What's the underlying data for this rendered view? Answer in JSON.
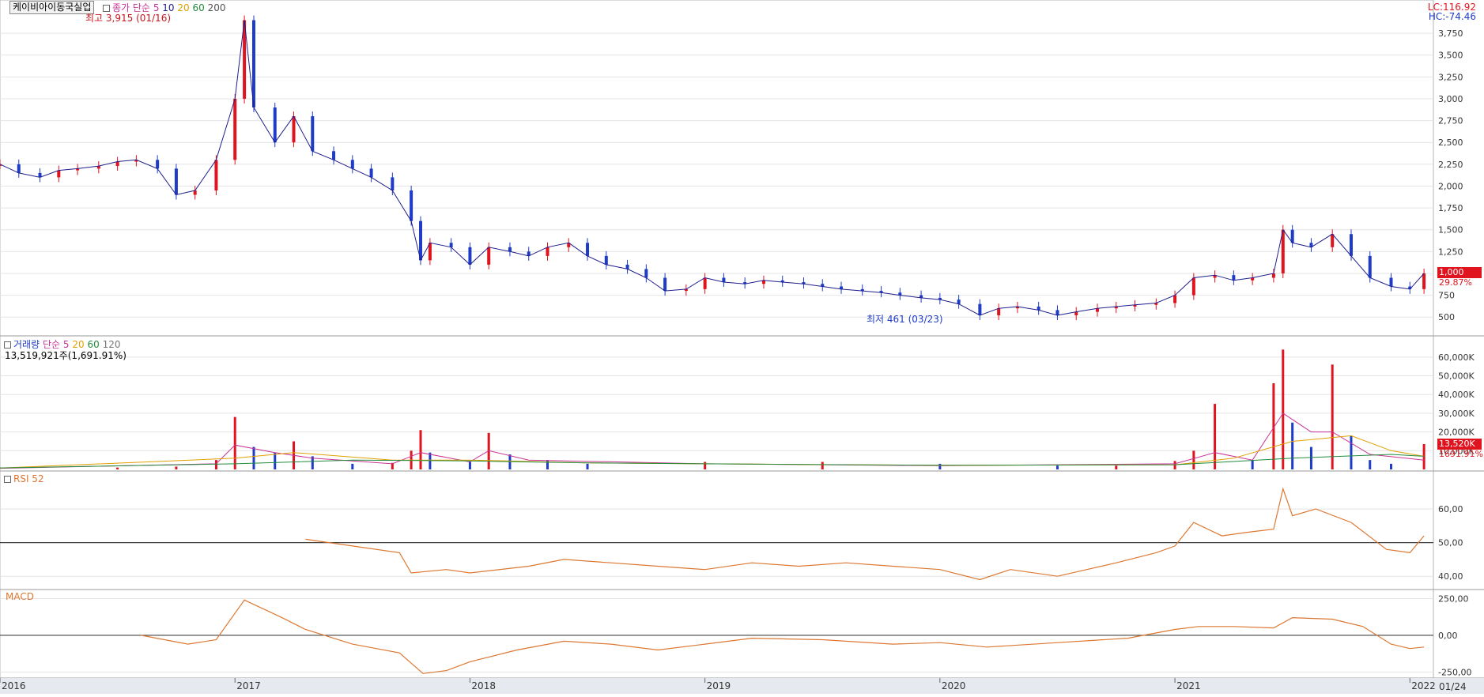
{
  "header": {
    "stock_name": "케이비아이동국실업",
    "price_ma_label": "종가 단순",
    "price_ma_periods": [
      "5",
      "10",
      "20",
      "60",
      "200"
    ],
    "price_ma_colors": [
      "#c83296",
      "#1e1e8c",
      "#e1a000",
      "#228b3c",
      "#555555"
    ],
    "lc": "LC:116.92",
    "hc": "HC:-74.46"
  },
  "annotations": {
    "high": "최고 3,915 (01/16)",
    "low": "최저 461 (03/23)"
  },
  "price_tags": {
    "last": "1,000",
    "change": "29.87%"
  },
  "volume_header": {
    "label": "거래량",
    "ma_label": "단순",
    "periods": [
      "5",
      "20",
      "60",
      "120"
    ],
    "info": "13,519,921주(1,691.91%)"
  },
  "volume_tags": {
    "last": "13,520K",
    "pct": "1691.91%"
  },
  "rsi_label": "RSI 52",
  "macd_label": "MACD",
  "x_axis": {
    "labels": [
      "2016",
      "2017",
      "2018",
      "2019",
      "2020",
      "2021",
      "2022"
    ],
    "right_label": "01/24"
  },
  "colors": {
    "up": "#e0141e",
    "down": "#1e3cc8",
    "rsi": "#dc7832",
    "macd": "#dc7832",
    "axis_text": "#333333",
    "tag_bg": "#e0141e"
  },
  "chart_data": [
    {
      "type": "line",
      "name": "price",
      "x_start": "2016-01",
      "x_end": "2022-01",
      "ylim": [
        330,
        3950
      ],
      "yticks": [
        "500",
        "750",
        "1,000",
        "1,250",
        "1,500",
        "1,750",
        "2,000",
        "2,250",
        "2,500",
        "2,750",
        "3,000",
        "3,250",
        "3,500",
        "3,750"
      ],
      "series": [
        {
          "values": [
            [
              2016.0,
              2250
            ],
            [
              2016.08,
              2150
            ],
            [
              2016.17,
              2100
            ],
            [
              2016.25,
              2180
            ],
            [
              2016.33,
              2200
            ],
            [
              2016.42,
              2230
            ],
            [
              2016.5,
              2280
            ],
            [
              2016.58,
              2300
            ],
            [
              2016.67,
              2200
            ],
            [
              2016.75,
              1900
            ],
            [
              2016.83,
              1950
            ],
            [
              2016.92,
              2300
            ],
            [
              2017.0,
              3000
            ],
            [
              2017.04,
              3900
            ],
            [
              2017.08,
              2900
            ],
            [
              2017.17,
              2500
            ],
            [
              2017.25,
              2800
            ],
            [
              2017.33,
              2400
            ],
            [
              2017.42,
              2300
            ],
            [
              2017.5,
              2200
            ],
            [
              2017.58,
              2100
            ],
            [
              2017.67,
              1950
            ],
            [
              2017.75,
              1600
            ],
            [
              2017.79,
              1150
            ],
            [
              2017.83,
              1350
            ],
            [
              2017.92,
              1300
            ],
            [
              2018.0,
              1100
            ],
            [
              2018.08,
              1300
            ],
            [
              2018.17,
              1250
            ],
            [
              2018.25,
              1200
            ],
            [
              2018.33,
              1300
            ],
            [
              2018.42,
              1350
            ],
            [
              2018.5,
              1200
            ],
            [
              2018.58,
              1100
            ],
            [
              2018.67,
              1050
            ],
            [
              2018.75,
              950
            ],
            [
              2018.83,
              800
            ],
            [
              2018.92,
              820
            ],
            [
              2019.0,
              950
            ],
            [
              2019.08,
              900
            ],
            [
              2019.17,
              880
            ],
            [
              2019.25,
              920
            ],
            [
              2019.33,
              900
            ],
            [
              2019.42,
              880
            ],
            [
              2019.5,
              850
            ],
            [
              2019.58,
              820
            ],
            [
              2019.67,
              800
            ],
            [
              2019.75,
              780
            ],
            [
              2019.83,
              750
            ],
            [
              2019.92,
              720
            ],
            [
              2020.0,
              700
            ],
            [
              2020.08,
              650
            ],
            [
              2020.17,
              520
            ],
            [
              2020.25,
              600
            ],
            [
              2020.33,
              620
            ],
            [
              2020.42,
              580
            ],
            [
              2020.5,
              520
            ],
            [
              2020.58,
              560
            ],
            [
              2020.67,
              600
            ],
            [
              2020.75,
              620
            ],
            [
              2020.83,
              640
            ],
            [
              2020.92,
              660
            ],
            [
              2021.0,
              750
            ],
            [
              2021.08,
              950
            ],
            [
              2021.17,
              980
            ],
            [
              2021.25,
              920
            ],
            [
              2021.33,
              950
            ],
            [
              2021.42,
              1000
            ],
            [
              2021.46,
              1500
            ],
            [
              2021.5,
              1350
            ],
            [
              2021.58,
              1300
            ],
            [
              2021.67,
              1450
            ],
            [
              2021.75,
              1200
            ],
            [
              2021.83,
              950
            ],
            [
              2021.92,
              850
            ],
            [
              2022.0,
              820
            ],
            [
              2022.06,
              1000
            ]
          ]
        }
      ]
    },
    {
      "type": "bar",
      "name": "volume",
      "ylim": [
        0,
        65000
      ],
      "yticks": [
        "10,000K",
        "20,000K",
        "30,000K",
        "40,000K",
        "50,000K",
        "60,000K"
      ],
      "series": [
        {
          "values": [
            [
              2016.5,
              1000
            ],
            [
              2016.75,
              1500
            ],
            [
              2016.92,
              5000
            ],
            [
              2017.0,
              28000
            ],
            [
              2017.08,
              12000
            ],
            [
              2017.17,
              9000
            ],
            [
              2017.25,
              15000
            ],
            [
              2017.33,
              7000
            ],
            [
              2017.5,
              3000
            ],
            [
              2017.67,
              3500
            ],
            [
              2017.75,
              10000
            ],
            [
              2017.79,
              21000
            ],
            [
              2017.83,
              9000
            ],
            [
              2018.0,
              4000
            ],
            [
              2018.08,
              19500
            ],
            [
              2018.17,
              8000
            ],
            [
              2018.33,
              5000
            ],
            [
              2018.5,
              3000
            ],
            [
              2019.0,
              4000
            ],
            [
              2019.5,
              4000
            ],
            [
              2020.0,
              3000
            ],
            [
              2020.5,
              2000
            ],
            [
              2020.75,
              2000
            ],
            [
              2021.0,
              4500
            ],
            [
              2021.08,
              10000
            ],
            [
              2021.17,
              35000
            ],
            [
              2021.33,
              5000
            ],
            [
              2021.42,
              46000
            ],
            [
              2021.46,
              64000
            ],
            [
              2021.5,
              25000
            ],
            [
              2021.58,
              12000
            ],
            [
              2021.67,
              56000
            ],
            [
              2021.75,
              18000
            ],
            [
              2021.83,
              5000
            ],
            [
              2021.92,
              3000
            ],
            [
              2022.06,
              13520
            ]
          ]
        },
        {
          "name": "5",
          "values": [
            [
              2016.0,
              600
            ],
            [
              2016.92,
              3000
            ],
            [
              2017.0,
              13000
            ],
            [
              2017.17,
              9000
            ],
            [
              2017.33,
              6000
            ],
            [
              2017.67,
              3000
            ],
            [
              2017.79,
              9000
            ],
            [
              2018.0,
              4000
            ],
            [
              2018.08,
              10000
            ],
            [
              2018.25,
              5000
            ],
            [
              2019.0,
              3000
            ],
            [
              2020.0,
              2000
            ],
            [
              2021.0,
              3000
            ],
            [
              2021.17,
              9000
            ],
            [
              2021.33,
              5000
            ],
            [
              2021.46,
              30000
            ],
            [
              2021.58,
              20000
            ],
            [
              2021.67,
              20000
            ],
            [
              2021.83,
              8000
            ],
            [
              2022.06,
              5000
            ]
          ]
        },
        {
          "name": "20",
          "values": [
            [
              2016.0,
              700
            ],
            [
              2017.0,
              6000
            ],
            [
              2017.25,
              9000
            ],
            [
              2017.67,
              5000
            ],
            [
              2018.0,
              5000
            ],
            [
              2018.5,
              3500
            ],
            [
              2019.0,
              3000
            ],
            [
              2020.0,
              2200
            ],
            [
              2021.0,
              2500
            ],
            [
              2021.25,
              6000
            ],
            [
              2021.5,
              15000
            ],
            [
              2021.75,
              18000
            ],
            [
              2021.92,
              10000
            ],
            [
              2022.06,
              7000
            ]
          ]
        },
        {
          "name": "60",
          "values": [
            [
              2016.0,
              800
            ],
            [
              2017.0,
              3000
            ],
            [
              2017.5,
              5000
            ],
            [
              2018.0,
              4500
            ],
            [
              2018.5,
              3500
            ],
            [
              2019.0,
              3000
            ],
            [
              2020.0,
              2200
            ],
            [
              2021.0,
              2500
            ],
            [
              2021.5,
              6000
            ],
            [
              2021.92,
              8000
            ],
            [
              2022.06,
              7000
            ]
          ]
        }
      ]
    },
    {
      "type": "line",
      "name": "RSI",
      "ylim": [
        37,
        68
      ],
      "yticks": [
        "40,00",
        "50,00",
        "60,00"
      ],
      "reference": 50,
      "series": [
        {
          "values": [
            [
              2017.3,
              51
            ],
            [
              2017.5,
              49
            ],
            [
              2017.7,
              47
            ],
            [
              2017.75,
              41
            ],
            [
              2017.9,
              42
            ],
            [
              2018.0,
              41
            ],
            [
              2018.25,
              43
            ],
            [
              2018.4,
              45
            ],
            [
              2018.6,
              44
            ],
            [
              2018.8,
              43
            ],
            [
              2019.0,
              42
            ],
            [
              2019.2,
              44
            ],
            [
              2019.4,
              43
            ],
            [
              2019.6,
              44
            ],
            [
              2019.8,
              43
            ],
            [
              2020.0,
              42
            ],
            [
              2020.17,
              39
            ],
            [
              2020.3,
              42
            ],
            [
              2020.5,
              40
            ],
            [
              2020.75,
              44
            ],
            [
              2020.92,
              47
            ],
            [
              2021.0,
              49
            ],
            [
              2021.08,
              56
            ],
            [
              2021.2,
              52
            ],
            [
              2021.3,
              53
            ],
            [
              2021.42,
              54
            ],
            [
              2021.46,
              66
            ],
            [
              2021.5,
              58
            ],
            [
              2021.6,
              60
            ],
            [
              2021.75,
              56
            ],
            [
              2021.9,
              48
            ],
            [
              2022.0,
              47
            ],
            [
              2022.06,
              52
            ]
          ]
        }
      ]
    },
    {
      "type": "line",
      "name": "MACD",
      "ylim": [
        -280,
        290
      ],
      "yticks": [
        "-250,00",
        "0,00",
        "250,00"
      ],
      "reference": 0,
      "series": [
        {
          "values": [
            [
              2016.6,
              0
            ],
            [
              2016.8,
              -60
            ],
            [
              2016.92,
              -30
            ],
            [
              2017.04,
              240
            ],
            [
              2017.2,
              120
            ],
            [
              2017.3,
              40
            ],
            [
              2017.5,
              -60
            ],
            [
              2017.7,
              -120
            ],
            [
              2017.8,
              -260
            ],
            [
              2017.9,
              -240
            ],
            [
              2018.0,
              -180
            ],
            [
              2018.2,
              -100
            ],
            [
              2018.4,
              -40
            ],
            [
              2018.6,
              -60
            ],
            [
              2018.8,
              -100
            ],
            [
              2019.0,
              -60
            ],
            [
              2019.2,
              -20
            ],
            [
              2019.5,
              -30
            ],
            [
              2019.8,
              -60
            ],
            [
              2020.0,
              -50
            ],
            [
              2020.2,
              -80
            ],
            [
              2020.5,
              -50
            ],
            [
              2020.8,
              -20
            ],
            [
              2021.0,
              40
            ],
            [
              2021.1,
              60
            ],
            [
              2021.25,
              60
            ],
            [
              2021.42,
              50
            ],
            [
              2021.5,
              120
            ],
            [
              2021.67,
              110
            ],
            [
              2021.8,
              60
            ],
            [
              2021.92,
              -60
            ],
            [
              2022.0,
              -90
            ],
            [
              2022.06,
              -80
            ]
          ]
        }
      ]
    }
  ]
}
